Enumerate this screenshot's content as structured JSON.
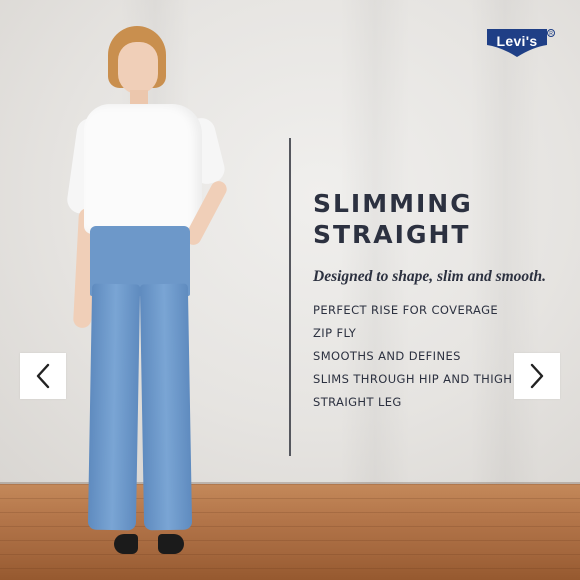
{
  "brand": {
    "logo_text": "Levi's",
    "logo_color": "#1f3f86"
  },
  "product": {
    "title_line1": "SLIMMING",
    "title_line2": "STRAIGHT",
    "tagline": "Designed to shape, slim and smooth.",
    "features": [
      "PERFECT RISE FOR COVERAGE",
      "ZIP FLY",
      "SMOOTHS AND DEFINES",
      "SLIMS THROUGH HIP AND THIGH",
      "STRAIGHT LEG"
    ]
  },
  "carousel": {
    "prev_icon": "chevron-left-icon",
    "next_icon": "chevron-right-icon"
  },
  "colors": {
    "text": "#2c3140",
    "backdrop": "#e9e7e4",
    "floor": "#b4764a",
    "denim": "#6d98c9"
  }
}
